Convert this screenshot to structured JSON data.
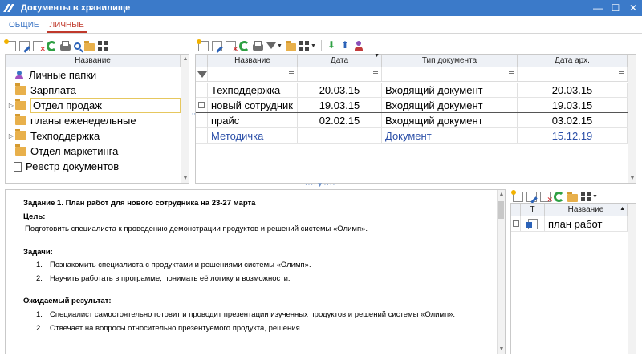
{
  "window": {
    "title": "Документы в хранилище"
  },
  "tabs": [
    {
      "label": "ОБЩИЕ",
      "active": false
    },
    {
      "label": "ЛИЧНЫЕ",
      "active": true
    }
  ],
  "tree": {
    "header": "Название",
    "items": [
      {
        "label": "Личные папки",
        "icon": "personal-folders-icon",
        "expandable": false,
        "indent": 0
      },
      {
        "label": "Зарплата",
        "icon": "folder-icon",
        "expandable": false,
        "indent": 1
      },
      {
        "label": "Отдел продаж",
        "icon": "folder-icon",
        "expandable": true,
        "indent": 1,
        "selected": true
      },
      {
        "label": "планы еженедельные",
        "icon": "folder-icon",
        "expandable": false,
        "indent": 1
      },
      {
        "label": "Техподдержка",
        "icon": "folder-icon",
        "expandable": true,
        "indent": 1
      },
      {
        "label": "Отдел маркетинга",
        "icon": "folder-icon",
        "expandable": false,
        "indent": 1
      },
      {
        "label": "Реестр документов",
        "icon": "document-icon",
        "expandable": false,
        "indent": 0
      }
    ]
  },
  "grid": {
    "columns": [
      "Название",
      "Дата",
      "Тип документа",
      "Дата арх."
    ],
    "rows": [
      {
        "name": "Техподдержка",
        "date": "20.03.15",
        "type": "Входящий документ",
        "archive_date": "20.03.15"
      },
      {
        "name": "новый сотрудник",
        "date": "19.03.15",
        "type": "Входящий документ",
        "archive_date": "19.03.15"
      },
      {
        "name": "прайс",
        "date": "02.02.15",
        "type": "Входящий документ",
        "archive_date": "03.02.15"
      },
      {
        "name": "Методичка",
        "date": "",
        "type": "Документ",
        "archive_date": "15.12.19",
        "link": true
      }
    ]
  },
  "document": {
    "title": "Задание 1. План работ для нового сотрудника на 23-27 марта",
    "goal_heading": "Цель:",
    "goal_text": "Подготовить специалиста к проведению демонстрации продуктов и решений системы «Олимп».",
    "tasks_heading": "Задачи:",
    "tasks": [
      {
        "num": "1.",
        "text": "Познакомить специалиста с продуктами и решениями системы «Олимп»."
      },
      {
        "num": "2.",
        "text": "Научить работать в программе, понимать её логику и возможности."
      }
    ],
    "result_heading": "Ожидаемый результат:",
    "results": [
      {
        "num": "1.",
        "text": "Специалист самостоятельно готовит и проводит презентации изученных продуктов и решений системы «Олимп»."
      },
      {
        "num": "2.",
        "text": "Отвечает на вопросы относительно презентуемого продукта, решения."
      }
    ]
  },
  "attachments": {
    "columns": [
      "T",
      "Название"
    ],
    "rows": [
      {
        "name": "план работ",
        "icon": "word-doc-icon"
      }
    ]
  },
  "colors": {
    "titlebar": "#3b7ac9",
    "active_tab": "#c0392b",
    "tab": "#3a74c4",
    "link": "#2b4fa8"
  }
}
